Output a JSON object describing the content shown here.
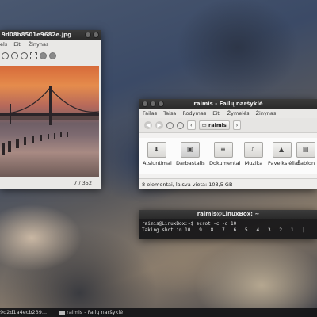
{
  "viewer": {
    "title": "9d08b8501e9682e.jpg",
    "menu": [
      "els",
      "Eiti",
      "Žinynas"
    ],
    "counter": "7 / 352"
  },
  "file_manager": {
    "title": "raimis - Failų naršyklė",
    "menu": [
      "Failas",
      "Taisa",
      "Rodymas",
      "Eiti",
      "Žymelės",
      "Žinynas"
    ],
    "breadcrumb": "raimis",
    "folders": [
      "Atsiuntimai",
      "Darbastalis",
      "Dokumentai",
      "Muzika",
      "Paveikslėliai",
      "Šablon"
    ],
    "status": "8 elementai, laisva vieta: 103,5 GB"
  },
  "terminal": {
    "title": "raimis@LinuxBox: ~",
    "lines": [
      "raimis@LinuxBox:~$ scrot -c -d 10",
      "Taking shot in 10.. 9.. 8.. 7.. 6.. 5.. 4.. 3.. 2.. 1.. |"
    ]
  },
  "taskbar": {
    "items": [
      "9d2d1a4ecb239...",
      "raimis - Failų naršyklė"
    ]
  }
}
